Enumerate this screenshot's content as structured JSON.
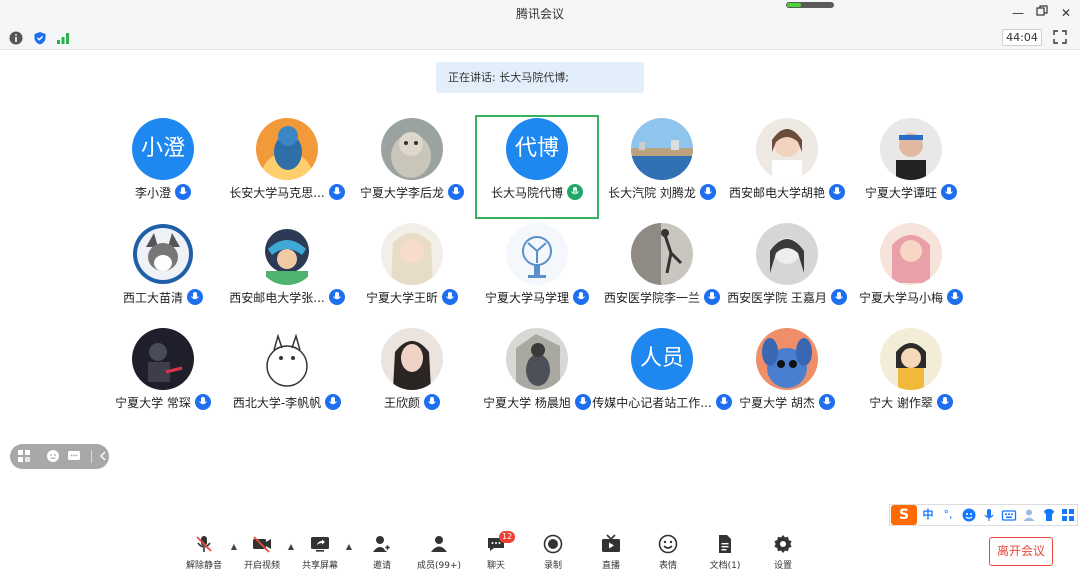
{
  "window": {
    "title": "腾讯会议",
    "controls": [
      "minimize-icon",
      "restore-icon",
      "close-icon"
    ]
  },
  "status_bar": {
    "icons": [
      "info-icon",
      "shield-icon",
      "signal-icon"
    ],
    "timer": "44:04"
  },
  "speaking_banner": "正在讲话: 长大马院代博;",
  "participants": [
    {
      "name": "李小澄",
      "avatar_text": "小澄",
      "avatar": "text",
      "speaking": false
    },
    {
      "name": "长安大学马克思...",
      "avatar": "photo-dog-sunset",
      "speaking": false
    },
    {
      "name": "宁夏大学李后龙",
      "avatar": "photo-cat",
      "speaking": false
    },
    {
      "name": "长大马院代博",
      "avatar_text": "代博",
      "avatar": "text",
      "speaking": true
    },
    {
      "name": "长大汽院 刘腾龙",
      "avatar": "photo-city-lake",
      "speaking": false
    },
    {
      "name": "西安邮电大学胡艳",
      "avatar": "photo-girl",
      "speaking": false
    },
    {
      "name": "宁夏大学谭旺",
      "avatar": "photo-boy-headband",
      "speaking": false
    },
    {
      "name": "西工大苗清",
      "avatar": "photo-husky",
      "speaking": false
    },
    {
      "name": "西安邮电大学张...",
      "avatar": "photo-anime-helmet",
      "speaking": false
    },
    {
      "name": "宁夏大学王昕",
      "avatar": "photo-blonde-girl",
      "speaking": false
    },
    {
      "name": "宁夏大学马学理",
      "avatar": "photo-fan-sketch",
      "speaking": false
    },
    {
      "name": "西安医学院李一兰",
      "avatar": "photo-dancer",
      "speaking": false
    },
    {
      "name": "西安医学院 王嘉月",
      "avatar": "photo-bw-girl",
      "speaking": false
    },
    {
      "name": "宁夏大学马小梅",
      "avatar": "photo-pink-girl",
      "speaking": false
    },
    {
      "name": "宁夏大学 常琛",
      "avatar": "photo-dark-figure",
      "speaking": false
    },
    {
      "name": "西北大学-李帆帆",
      "avatar": "photo-totoro-sketch",
      "speaking": false
    },
    {
      "name": "王欣颜",
      "avatar": "photo-woman-portrait",
      "speaking": false
    },
    {
      "name": "宁夏大学 杨晨旭",
      "avatar": "photo-backpacker",
      "speaking": false
    },
    {
      "name": "传媒中心记者站工作...",
      "avatar_text": "人员",
      "avatar": "text",
      "speaking": false
    },
    {
      "name": "宁夏大学 胡杰",
      "avatar": "photo-stitch",
      "speaking": false
    },
    {
      "name": "宁大 谢作翠",
      "avatar": "photo-cartoon-girl",
      "speaking": false
    }
  ],
  "float_toolbar": [
    "grid-view-icon",
    "face-icon",
    "chat-icon",
    "collapse-icon"
  ],
  "ime_bar": {
    "logo": "S",
    "mode": "中",
    "items": [
      "punctuation-icon",
      "emoji-icon",
      "voice-icon",
      "keyboard-icon",
      "user-icon",
      "skin-icon",
      "menu-icon"
    ]
  },
  "toolbar": {
    "mute": "解除静音",
    "video": "开启视频",
    "share": "共享屏幕",
    "invite": "邀请",
    "members": "成员(99+)",
    "chat": "聊天",
    "chat_badge": "12",
    "record": "录制",
    "live": "直播",
    "reaction": "表情",
    "docs": "文档(1)",
    "settings": "设置",
    "leave": "离开会议"
  },
  "colors": {
    "accent": "#1e88f0",
    "active_border": "#36b35c",
    "leave": "#e84a3b",
    "badge": "#f04134"
  }
}
